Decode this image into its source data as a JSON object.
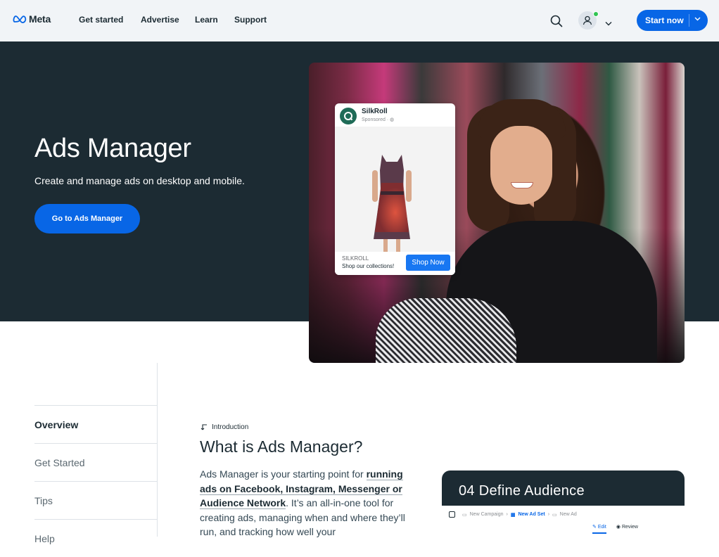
{
  "nav": {
    "logo_text": "Meta",
    "links": [
      "Get started",
      "Advertise",
      "Learn",
      "Support"
    ],
    "start_now": "Start now"
  },
  "hero": {
    "title": "Ads Manager",
    "subtitle": "Create and manage ads on desktop and mobile.",
    "cta": "Go to Ads Manager"
  },
  "ad_preview": {
    "page_name": "SilkRoll",
    "sponsored": "Sponsored · ",
    "brand_caption": "SILKROLL",
    "tagline": "Shop our collections!",
    "cta": "Shop Now"
  },
  "sidebar": {
    "items": [
      {
        "label": "Overview",
        "active": true
      },
      {
        "label": "Get Started",
        "active": false
      },
      {
        "label": "Tips",
        "active": false
      },
      {
        "label": "Help",
        "active": false
      }
    ]
  },
  "intro": {
    "eyebrow": "Introduction",
    "title": "What is Ads Manager?",
    "body_lead": "Ads Manager is your starting point for ",
    "body_link": "running ads on Facebook, Instagram, Messenger or Audience Network",
    "body_rest": ". It’s an all-in-one tool for creating ads, managing when and where they’ll run, and tracking how well your"
  },
  "audience_card": {
    "title": "04 Define Audience",
    "crumbs": [
      "New Campaign",
      "New Ad Set",
      "New Ad"
    ],
    "tabs": [
      "Edit",
      "Review"
    ]
  },
  "colors": {
    "brand_blue": "#0866e6",
    "hero_bg": "#1c2b33",
    "nav_bg": "#f1f4f7"
  }
}
